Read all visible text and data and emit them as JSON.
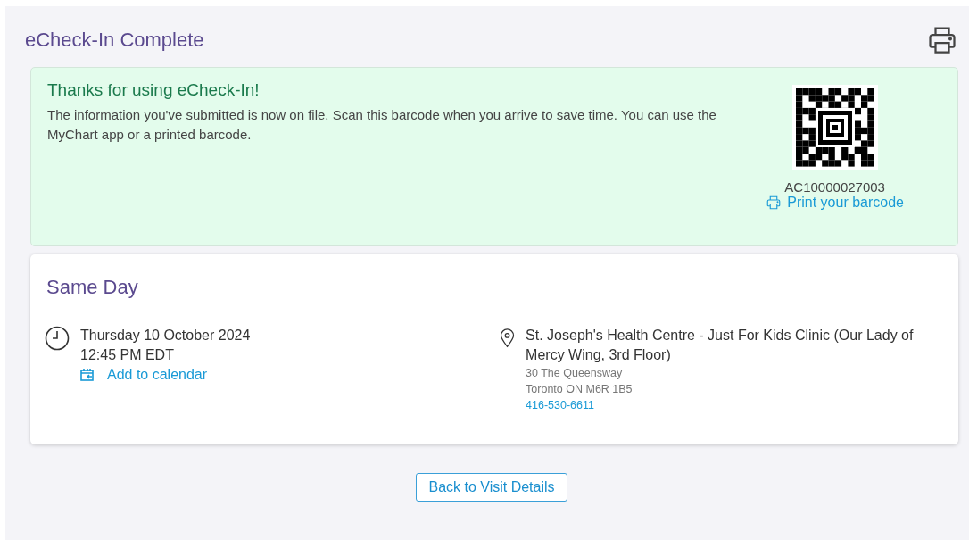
{
  "page": {
    "title": "eCheck-In Complete"
  },
  "confirmation": {
    "heading": "Thanks for using eCheck-In!",
    "message": "The information you've submitted is now on file. Scan this barcode when you arrive to save time. You can use the MyChart app or a printed barcode.",
    "barcode_number": "AC10000027003",
    "print_link": "Print your barcode"
  },
  "appointment": {
    "title": "Same Day",
    "date": "Thursday 10 October 2024",
    "time": "12:45 PM EDT",
    "calendar_link": "Add to calendar",
    "location": "St. Joseph's Health Centre - Just For Kids Clinic (Our Lady of Mercy Wing, 3rd Floor)",
    "address_lines": [
      "30 The Queensway",
      "Toronto ON M6R 1B5"
    ],
    "phone": "416-530-6611"
  },
  "back_button": "Back to Visit Details"
}
